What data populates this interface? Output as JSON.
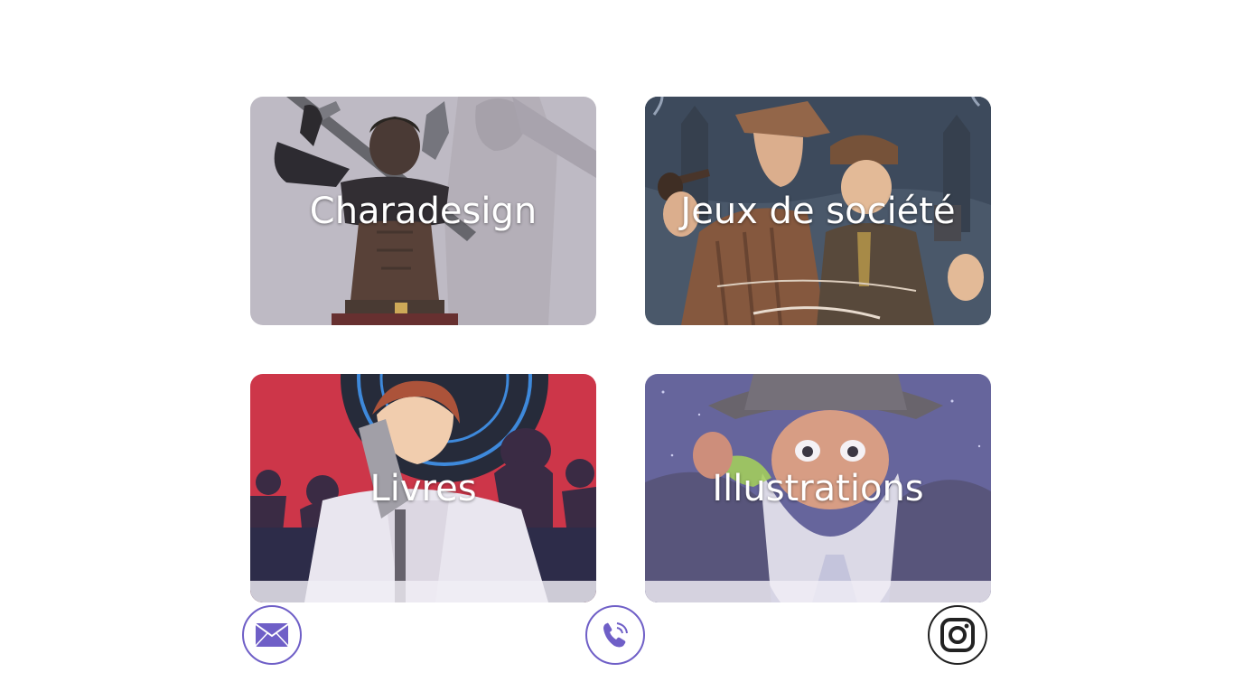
{
  "cards": [
    {
      "label": "Charadesign"
    },
    {
      "label": "Jeux de société"
    },
    {
      "label": "Livres"
    },
    {
      "label": "Illustrations"
    }
  ],
  "contact": {
    "mail_icon": "envelope-icon",
    "phone_icon": "phone-icon",
    "instagram_icon": "instagram-icon"
  },
  "colors": {
    "accent": "#6f5fc7",
    "instagram": "#222222",
    "label_text": "#ffffff"
  }
}
